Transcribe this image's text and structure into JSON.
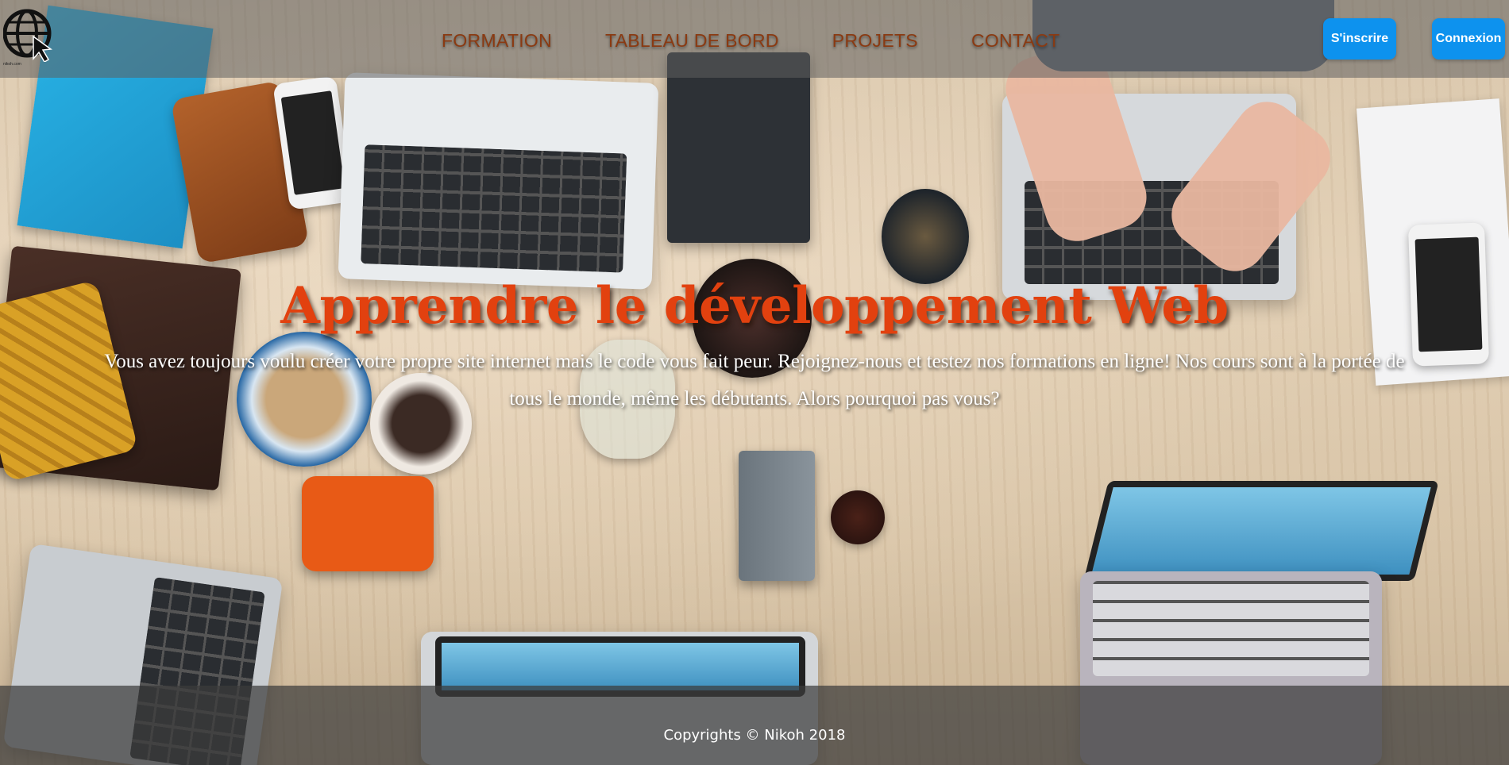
{
  "logo": {
    "icon": "globe-cursor-icon",
    "caption": "nikoh.com"
  },
  "nav": {
    "links": [
      {
        "label": "FORMATION"
      },
      {
        "label": "TABLEAU DE BORD"
      },
      {
        "label": "PROJETS"
      },
      {
        "label": "CONTACT"
      }
    ],
    "signup_label": "S'inscrire",
    "login_label": "Connexion"
  },
  "hero": {
    "title": "Apprendre le développement Web",
    "text": "Vous avez toujours voulu créer votre propre site internet mais le code vous fait peur. Rejoignez-nous et testez nos formations en ligne! Nos cours sont à la portée de tous le monde, même les débutants. Alors pourquoi pas vous?"
  },
  "footer": {
    "copyright": "Copyrights © Nikoh 2018"
  },
  "colors": {
    "nav_link": "#8a3a12",
    "button": "#0d92ee",
    "hero_title": "#e2410f"
  }
}
